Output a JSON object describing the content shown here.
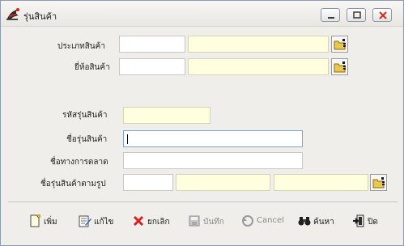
{
  "window": {
    "title": "รุ่นสินค้า",
    "icon_name": "app-logo-icon",
    "minimize_icon": "minimize-icon",
    "maximize_icon": "maximize-icon",
    "close_icon": "close-icon"
  },
  "form": {
    "product_type_label": "ประเภทสินค้า",
    "product_type_code": "",
    "product_type_name": "",
    "brand_label": "ยี่ห้อสินค้า",
    "brand_code": "",
    "brand_name": "",
    "model_code_label": "รหัสรุ่นสินค้า",
    "model_code": "",
    "model_name_label": "ชื่อรุ่นสินค้า",
    "model_name": "",
    "marketing_name_label": "ชื่อทางการตลาด",
    "marketing_name": "",
    "model_name_by_form_label": "ชื่อรุ่นสินค้าตามรูป",
    "model_form_value_1": "",
    "model_form_value_2": "",
    "model_form_value_3": ""
  },
  "toolbar": {
    "add_label": "เพิ่ม",
    "edit_label": "แก้ไข",
    "cancel_item_label": "ยกเลิก",
    "save_label": "บันทึก",
    "cancel_label": "Cancel",
    "search_label": "ค้นหา",
    "close_label": "ปิด"
  },
  "colors": {
    "readonly_field": "#ffffdf",
    "window_bg": "#f0eeea",
    "close_icon_red": "#d42a1c"
  }
}
